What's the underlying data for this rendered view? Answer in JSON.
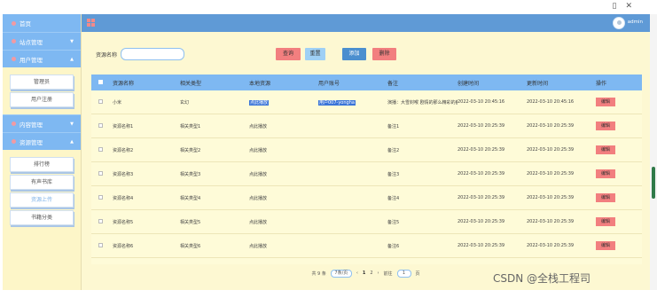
{
  "window": {
    "controls": [
      "▯",
      "✕"
    ]
  },
  "sidebar": {
    "home": "首页",
    "groups": [
      {
        "label": "站点管理",
        "items": []
      },
      {
        "label": "用户管理",
        "items": [
          "管理员",
          "用户注册"
        ]
      },
      {
        "label": "内容管理",
        "items": []
      },
      {
        "label": "资源管理",
        "items": [
          "排行榜",
          "有声书库",
          "资源上传",
          "书籍分类"
        ]
      }
    ],
    "active_item": "资源上传"
  },
  "topbar": {
    "user": "admin"
  },
  "search": {
    "label": "资源名称",
    "value": ""
  },
  "buttons": {
    "query": "查询",
    "reset": "重置",
    "add": "添加",
    "delete": "删除"
  },
  "table": {
    "headers": [
      "资源名称",
      "相关类型",
      "本地资源",
      "用户账号",
      "备注",
      "创建时间",
      "更新时间",
      "操作"
    ],
    "rows": [
      {
        "name": "小米",
        "type": "玄幻",
        "local": "点此播放",
        "account": "用户007-yongha",
        "note": "演播：大雪封喉 剧情的那么精彩的都是",
        "created": "2022-03-10 20:45:16",
        "updated": "2022-03-10 20:45:16",
        "action": "编辑"
      },
      {
        "name": "资源名称1",
        "type": "相关类型1",
        "local": "点此播放",
        "account": "",
        "note": "备注1",
        "created": "2022-03-10 20:25:39",
        "updated": "2022-03-10 20:25:39",
        "action": "编辑"
      },
      {
        "name": "资源名称2",
        "type": "相关类型2",
        "local": "点此播放",
        "account": "",
        "note": "备注2",
        "created": "2022-03-10 20:25:39",
        "updated": "2022-03-10 20:25:39",
        "action": "编辑"
      },
      {
        "name": "资源名称3",
        "type": "相关类型3",
        "local": "点此播放",
        "account": "",
        "note": "备注3",
        "created": "2022-03-10 20:25:39",
        "updated": "2022-03-10 20:25:39",
        "action": "编辑"
      },
      {
        "name": "资源名称4",
        "type": "相关类型4",
        "local": "点此播放",
        "account": "",
        "note": "备注4",
        "created": "2022-03-10 20:25:39",
        "updated": "2022-03-10 20:25:39",
        "action": "编辑"
      },
      {
        "name": "资源名称5",
        "type": "相关类型5",
        "local": "点此播放",
        "account": "",
        "note": "备注5",
        "created": "2022-03-10 20:25:39",
        "updated": "2022-03-10 20:25:39",
        "action": "编辑"
      },
      {
        "name": "资源名称6",
        "type": "相关类型6",
        "local": "点此播放",
        "account": "",
        "note": "备注6",
        "created": "2022-03-10 20:25:39",
        "updated": "2022-03-10 20:25:39",
        "action": "编辑"
      }
    ]
  },
  "pager": {
    "total": "共 9 条",
    "page_size": "7条/页",
    "prev": "‹",
    "pages": [
      "1",
      "2"
    ],
    "next": "›",
    "goto_label": "前往",
    "goto_value": "1",
    "page_unit": "页"
  },
  "watermark": "CSDN @全栈工程司",
  "colors": {
    "primary": "#7eb8f2",
    "topbar": "#5f9ad6",
    "danger": "#f27f7f",
    "sidebar_bg": "#fdf6c8",
    "content_bg": "#fdf8d2"
  }
}
